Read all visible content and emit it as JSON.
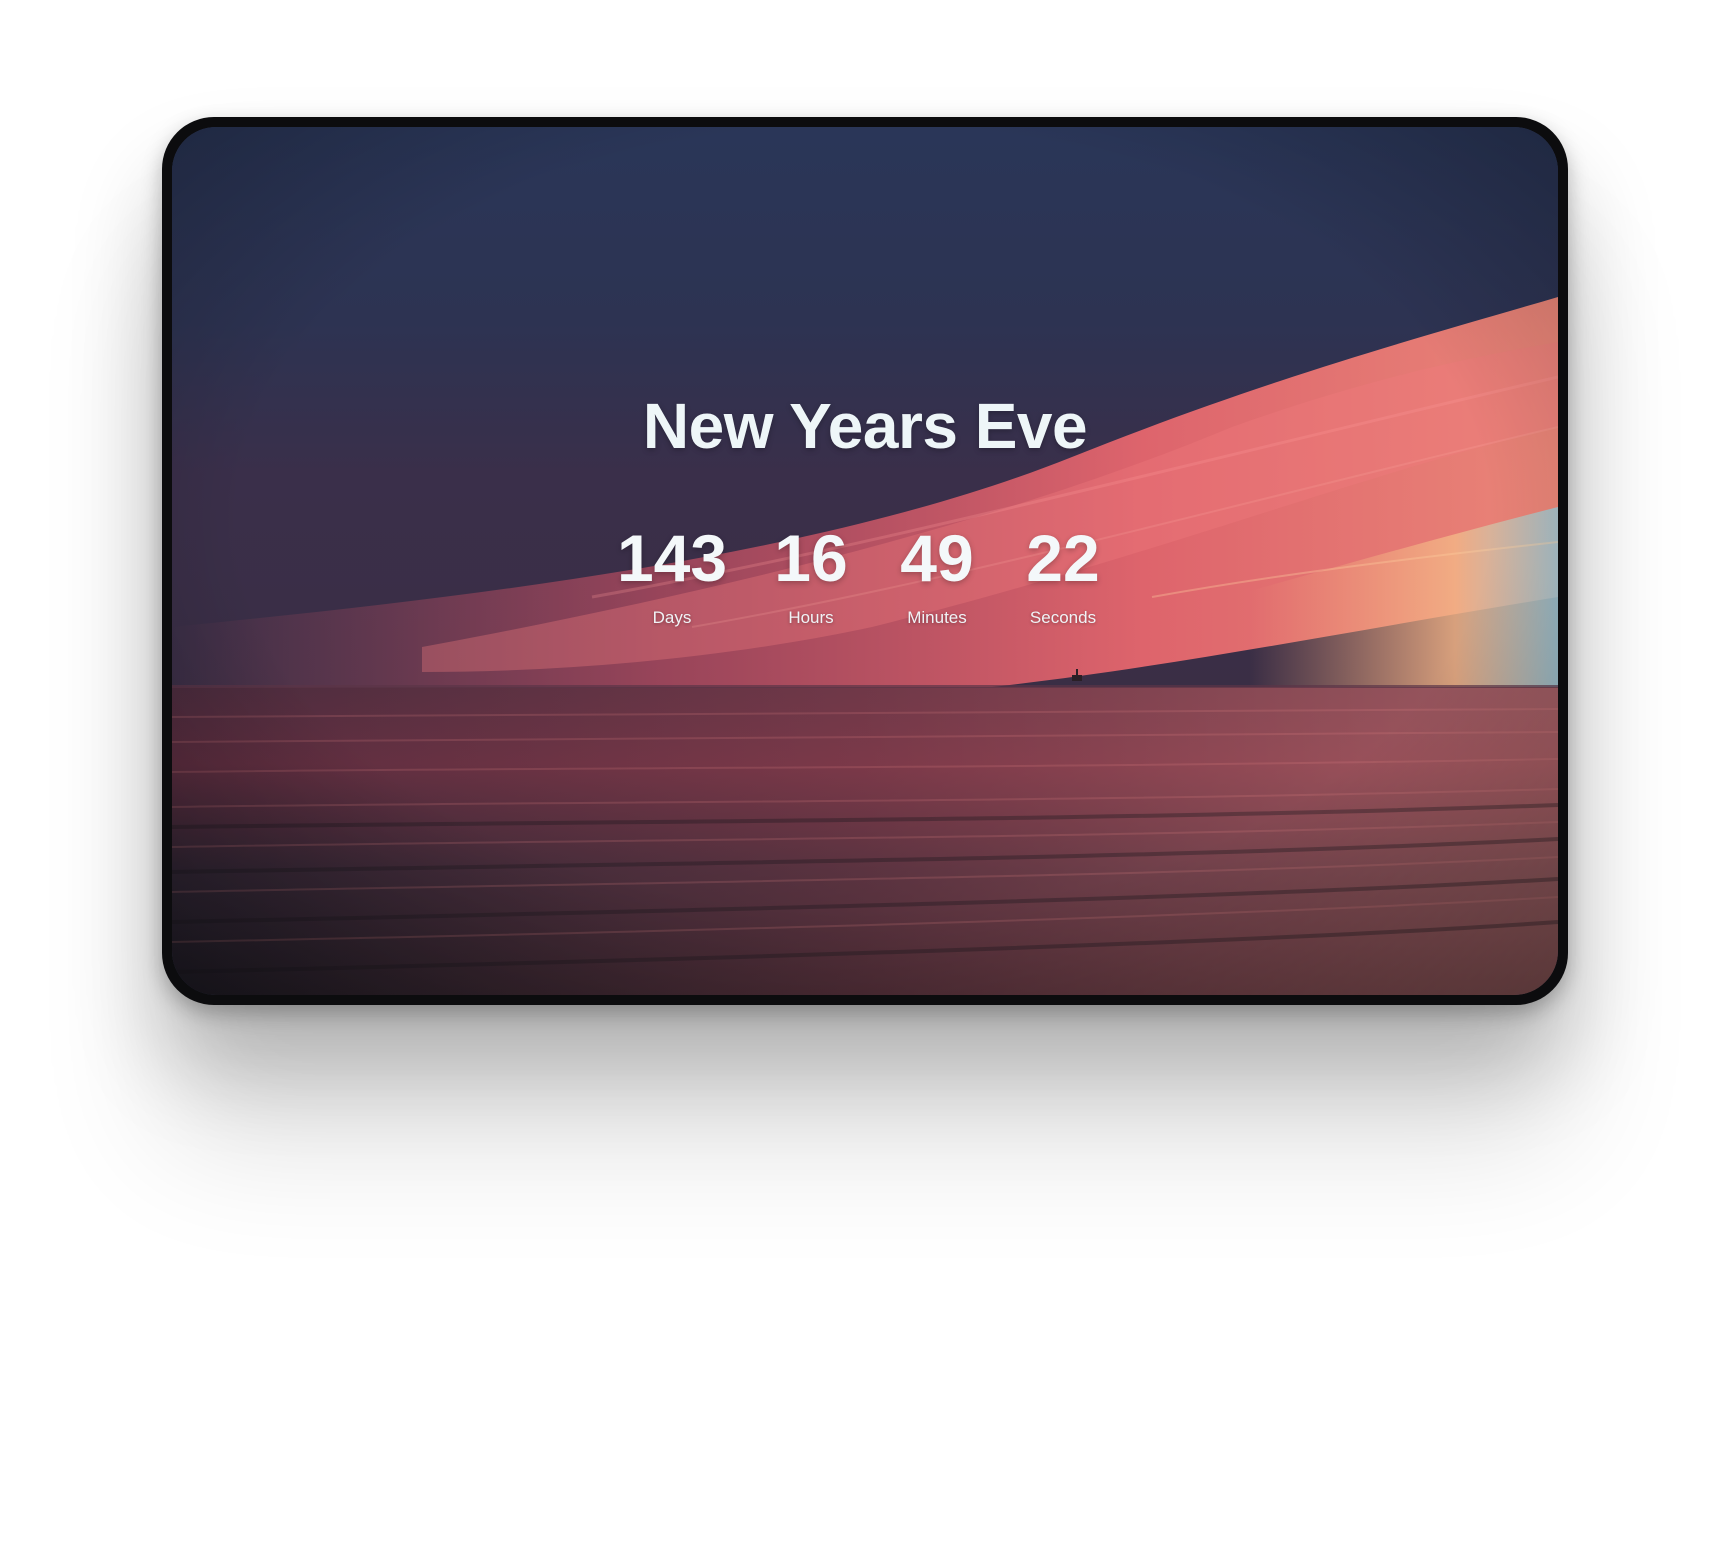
{
  "event": {
    "title": "New Years Eve"
  },
  "countdown": [
    {
      "value": "143",
      "label": "Days"
    },
    {
      "value": "16",
      "label": "Hours"
    },
    {
      "value": "49",
      "label": "Minutes"
    },
    {
      "value": "22",
      "label": "Seconds"
    }
  ],
  "colors": {
    "sky_top": "#2b3756",
    "sky_mid": "#323552",
    "cloud_pink": "#e8576a",
    "horizon_glow": "#f0a278",
    "sea_dark": "#1f1c26",
    "text": "#eef6f8"
  },
  "background": {
    "scene": "sunset-over-sea"
  }
}
